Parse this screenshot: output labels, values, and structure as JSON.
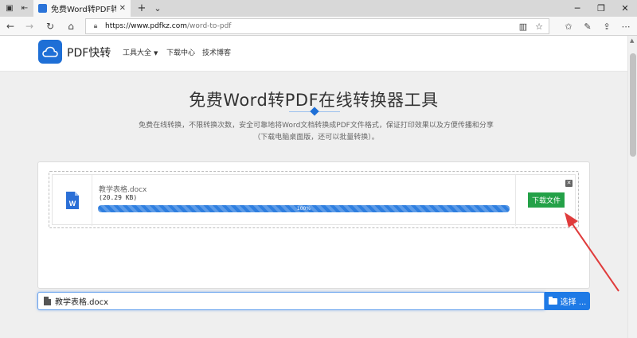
{
  "browser": {
    "tab_title": "免费Word转PDF转换器",
    "tab_close": "✕",
    "new_tab": "+",
    "tab_dropdown": "⌄",
    "url_host": "https://www.pdfkz.com",
    "url_path": "/word-to-pdf"
  },
  "header": {
    "brand": "PDF快转",
    "menu": [
      {
        "label": "工具大全",
        "caret": "▼"
      },
      {
        "label": "下载中心"
      },
      {
        "label": "技术博客"
      }
    ]
  },
  "hero": {
    "title": "免费Word转PDF在线转换器工具",
    "description": "免费在线转换，不限转换次数，安全可靠地将Word文档转换成PDF文件格式，保证打印效果以及方便传播和分享（下载电脑桌面版，还可以批量转换）。"
  },
  "upload": {
    "file_name": "教学表格.docx",
    "file_size": "(20.29 KB)",
    "progress_pct": 100,
    "progress_text": "100%",
    "remove_label": "✕",
    "download_label": "下载文件"
  },
  "file_input": {
    "value": "教学表格.docx",
    "browse_label": "选择 ..."
  },
  "colors": {
    "accent": "#1e6fd6",
    "download_green": "#24a148",
    "arrow_red": "#e03c3c"
  }
}
